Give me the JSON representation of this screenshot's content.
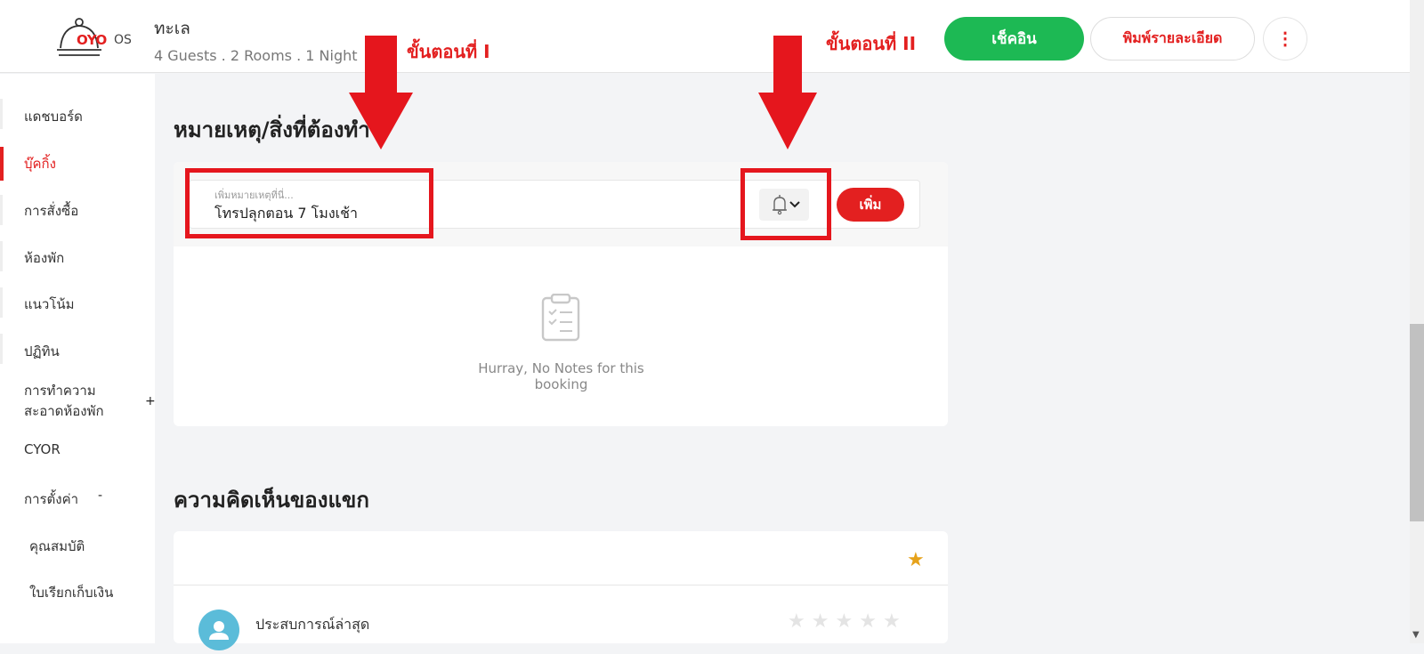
{
  "header": {
    "logo_brand": "OYO",
    "logo_suffix": "OS",
    "hotel_name": "ทะเล",
    "booking_summary": "4 Guests . 2 Rooms . 1 Night",
    "step_one": "ขั้นตอนที่ I",
    "step_two": "ขั้นตอนที่ II",
    "checkin_label": "เช็คอิน",
    "print_label": "พิมพ์รายละเอียด",
    "more_label": "⋮"
  },
  "sidebar": {
    "items": [
      {
        "label": "แดชบอร์ด"
      },
      {
        "label": "บุ๊คกิ้ง"
      },
      {
        "label": "การสั่งซื้อ"
      },
      {
        "label": "ห้องพัก"
      },
      {
        "label": "แนวโน้ม"
      },
      {
        "label": "ปฏิทิน"
      },
      {
        "label": "การทำความ สะอาดห้องพัก"
      },
      {
        "label": "CYOR"
      },
      {
        "label": "การตั้งค่า"
      }
    ],
    "sub_items": [
      {
        "label": "คุณสมบัติ"
      },
      {
        "label": "ใบเรียกเก็บเงิน"
      }
    ],
    "expand_symbol": "+",
    "collapse_symbol": "-"
  },
  "notes": {
    "title": "หมายเหตุ/สิ่งที่ต้องทำ",
    "placeholder": "เพิ่มหมายเหตุที่นี่...",
    "value": "โทรปลุกตอน 7 โมงเช้า",
    "add_label": "เพิ่ม",
    "empty_text": "Hurray, No Notes for this booking"
  },
  "feedback": {
    "title": "ความคิดเห็นของแขก",
    "experience_label": "ประสบการณ์ล่าสุด",
    "rating": 0,
    "star_symbol": "★"
  },
  "colors": {
    "brand_red": "#e32020",
    "checkin_green": "#1db954",
    "annotation_red": "#e5161d",
    "star_gold": "#e6a21a"
  }
}
